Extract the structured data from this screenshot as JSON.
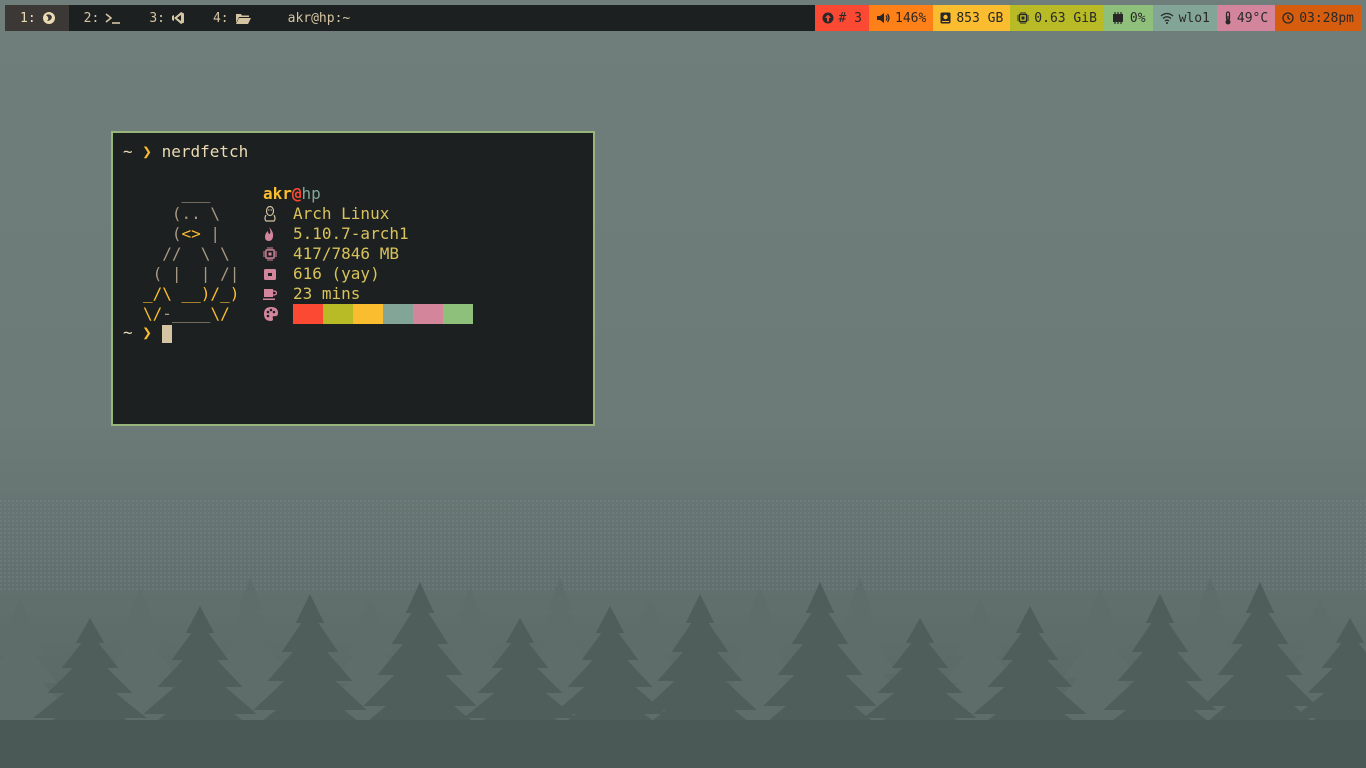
{
  "workspaces": [
    {
      "num": "1:",
      "icon": "firefox-icon",
      "active": true
    },
    {
      "num": "2:",
      "icon": "terminal-icon",
      "active": false
    },
    {
      "num": "3:",
      "icon": "vscode-icon",
      "active": false
    },
    {
      "num": "4:",
      "icon": "folder-icon",
      "active": false
    }
  ],
  "window_title": "akr@hp:~",
  "status": {
    "updates": {
      "text": "# 3",
      "icon": "arrow-up-circle-icon",
      "color": "#fb4934"
    },
    "volume": {
      "text": "146%",
      "icon": "speaker-icon",
      "color": "#fe8019"
    },
    "disk": {
      "text": "853 GB",
      "icon": "hdd-icon",
      "color": "#fabd2f"
    },
    "memory": {
      "text": "0.63 GiB",
      "icon": "cpu-chip-icon",
      "color": "#b8bb26"
    },
    "cpu": {
      "text": "0%",
      "icon": "memory-icon",
      "color": "#8ec07c"
    },
    "wifi": {
      "text": "wlo1",
      "icon": "wifi-icon",
      "color": "#83a598"
    },
    "temp": {
      "text": "49°C",
      "icon": "thermometer-icon",
      "color": "#d3869b"
    },
    "clock": {
      "text": "03:28pm",
      "icon": "clock-icon",
      "color": "#d65d0e"
    }
  },
  "terminal": {
    "prompt_tilde": "~",
    "prompt_arrow": "❯",
    "command": "nerdfetch",
    "ascii": {
      "l1": "    ___",
      "l2a": "   (.. \\",
      "l3a": "   (",
      "l3b": "<>",
      "l3c": " |",
      "l4": "  //  \\ \\",
      "l5": " ( |  | /|",
      "l6a": "_/\\ __)/_)",
      "l7a": "\\/",
      "l7b": "-____",
      "l7c": "\\/"
    },
    "user": "akr",
    "at": "@",
    "host": "hp",
    "os": "Arch Linux",
    "kernel": "5.10.7-arch1",
    "memory": "417/7846 MB",
    "packages": "616 (yay)",
    "uptime": "23 mins",
    "colors": [
      "#fb4934",
      "#fb4934",
      "#fb4934",
      "#b8bb26",
      "#b8bb26",
      "#b8bb26",
      "#fabd2f",
      "#fabd2f",
      "#fabd2f",
      "#83a598",
      "#83a598",
      "#83a598",
      "#d3869b",
      "#d3869b",
      "#d3869b",
      "#8ec07c",
      "#8ec07c",
      "#8ec07c"
    ]
  }
}
